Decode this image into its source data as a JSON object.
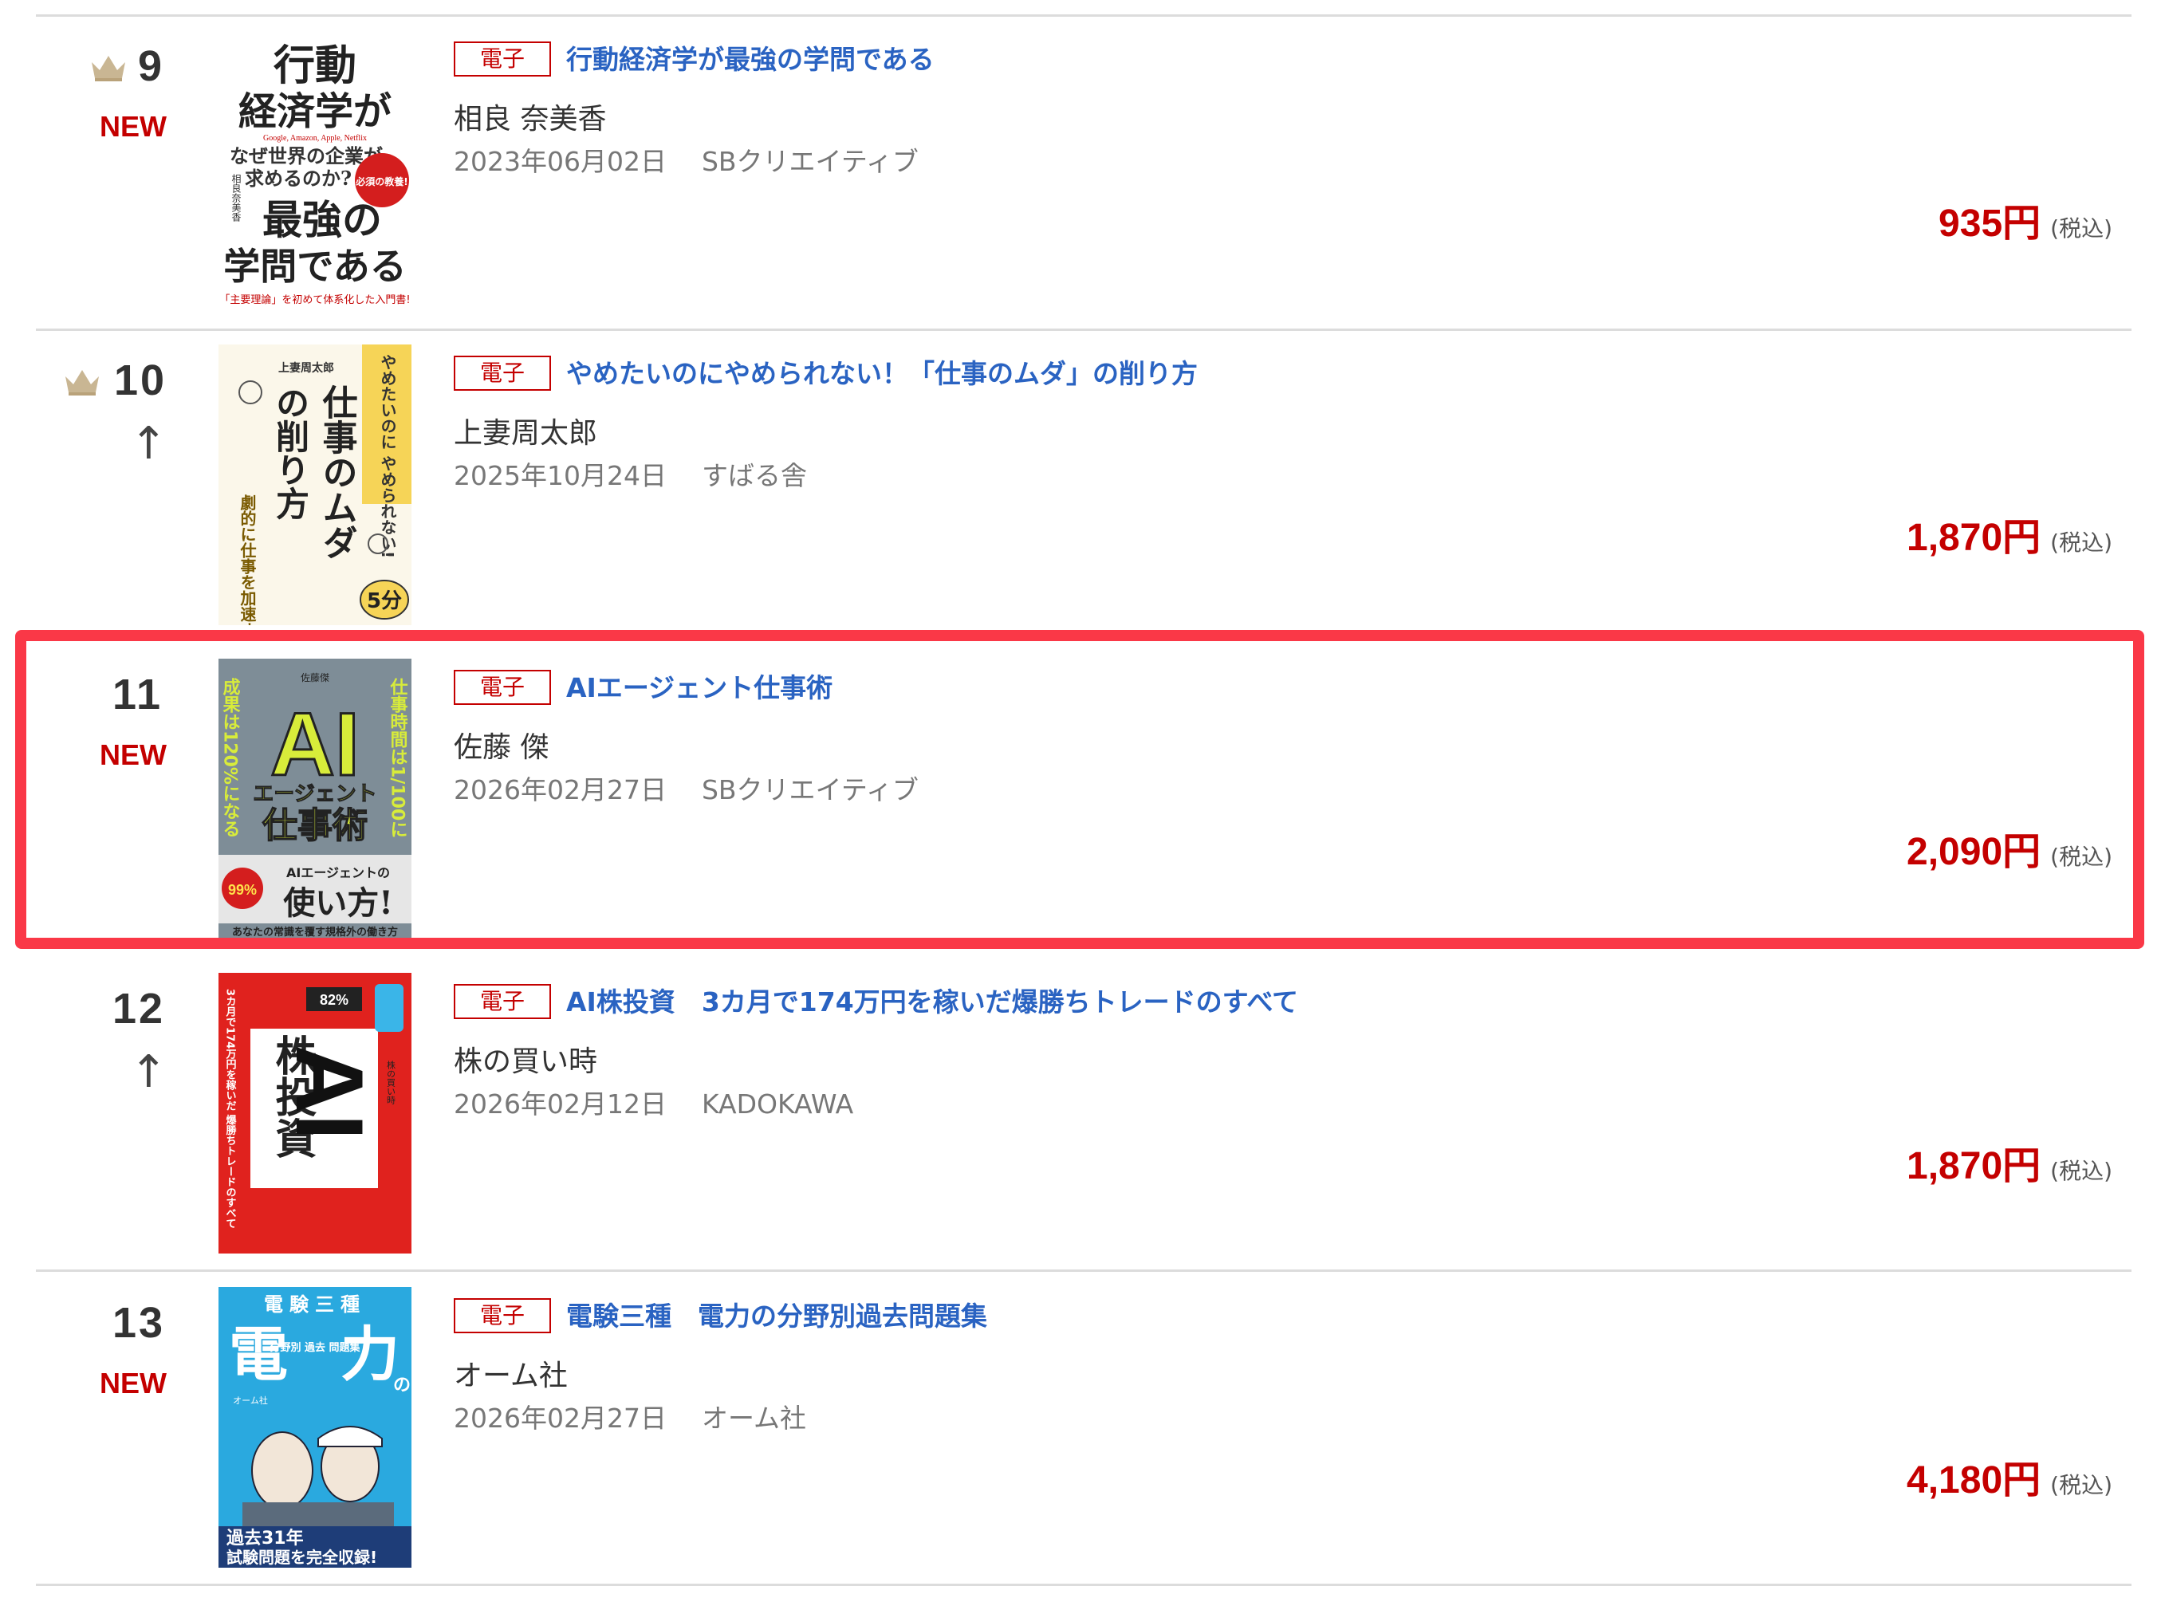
{
  "currency_suffix": "円",
  "tax_label": "(税込)",
  "badge_label": "電子",
  "colors": {
    "title_link": "#2a63c2",
    "price": "#c40000",
    "new_badge": "#c40000",
    "highlight_border": "#fa3847",
    "crown": "#b9a27a"
  },
  "items": [
    {
      "rank": "9",
      "status": "NEW",
      "crown": true,
      "badge": "電子",
      "title": "行動経済学が最強の学問である",
      "author": "相良 奈美香",
      "date": "2023年06月02日",
      "publisher": "SBクリエイティブ",
      "price": "935円",
      "tax": "(税込)",
      "cover": {
        "line1": "行動",
        "line2": "経済学が",
        "sub1": "Google, Amazon, Apple, Netflix",
        "sub2": "なぜ世界の企業が",
        "sub3": "求めるのか?",
        "stamp": "必須の教養!",
        "line3": "最強の",
        "line4": "学問である",
        "bottom": "「主要理論」を初めて体系化した入門書!",
        "author_vertical": "相良奈美香"
      }
    },
    {
      "rank": "10",
      "status": "↑",
      "crown": true,
      "badge": "電子",
      "title": "やめたいのにやめられない！「仕事のムダ」の削り方",
      "author": "上妻周太郎",
      "date": "2025年10月24日",
      "publisher": "すばる舎",
      "price": "1,870円",
      "tax": "(税込)",
      "cover": {
        "author_small": "上妻周太郎",
        "banner": "やめたいのに やめられない!",
        "main1": "仕事のムダ",
        "main2": "の削り方",
        "sub": "劇的に仕事を加速するコツ",
        "stamp": "5分"
      }
    },
    {
      "rank": "11",
      "status": "NEW",
      "crown": false,
      "highlighted": true,
      "badge": "電子",
      "title": "AIエージェント仕事術",
      "author": "佐藤 傑",
      "date": "2026年02月27日",
      "publisher": "SBクリエイティブ",
      "price": "2,090円",
      "tax": "(税込)",
      "cover": {
        "author_small": "佐藤傑",
        "left_vertical": "成果は120%になる",
        "right_vertical": "仕事時間は1/100に",
        "big": "AI",
        "mid": "エージェント",
        "main": "仕事術",
        "howto_small": "AIエージェントの",
        "howto": "使い方!",
        "badge": "99%",
        "bottom": "あなたの常識を覆す規格外の働き方"
      }
    },
    {
      "rank": "12",
      "status": "↑",
      "crown": false,
      "badge": "電子",
      "title": "AI株投資　3カ月で174万円を稼いだ爆勝ちトレードのすべて",
      "author": "株の買い時",
      "date": "2026年02月12日",
      "publisher": "KADOKAWA",
      "price": "1,870円",
      "tax": "(税込)",
      "cover": {
        "ai": "AI",
        "main": "株投資",
        "pct": "82%",
        "side": "3カ月で174万円を稼いだ 爆勝ちトレードのすべて",
        "author_vertical": "株の買い時"
      }
    },
    {
      "rank": "13",
      "status": "NEW",
      "crown": false,
      "badge": "電子",
      "title": "電験三種　電力の分野別過去問題集",
      "author": "オーム社",
      "date": "2026年02月27日",
      "publisher": "オーム社",
      "price": "4,180円",
      "tax": "(税込)",
      "cover": {
        "top": "電験三種",
        "left": "電",
        "right": "力",
        "no": "の",
        "mid": "分野別 過去 問題集",
        "pub": "オーム社",
        "bottom1": "過去31年",
        "bottom2": "試験問題を完全収録!"
      }
    }
  ]
}
